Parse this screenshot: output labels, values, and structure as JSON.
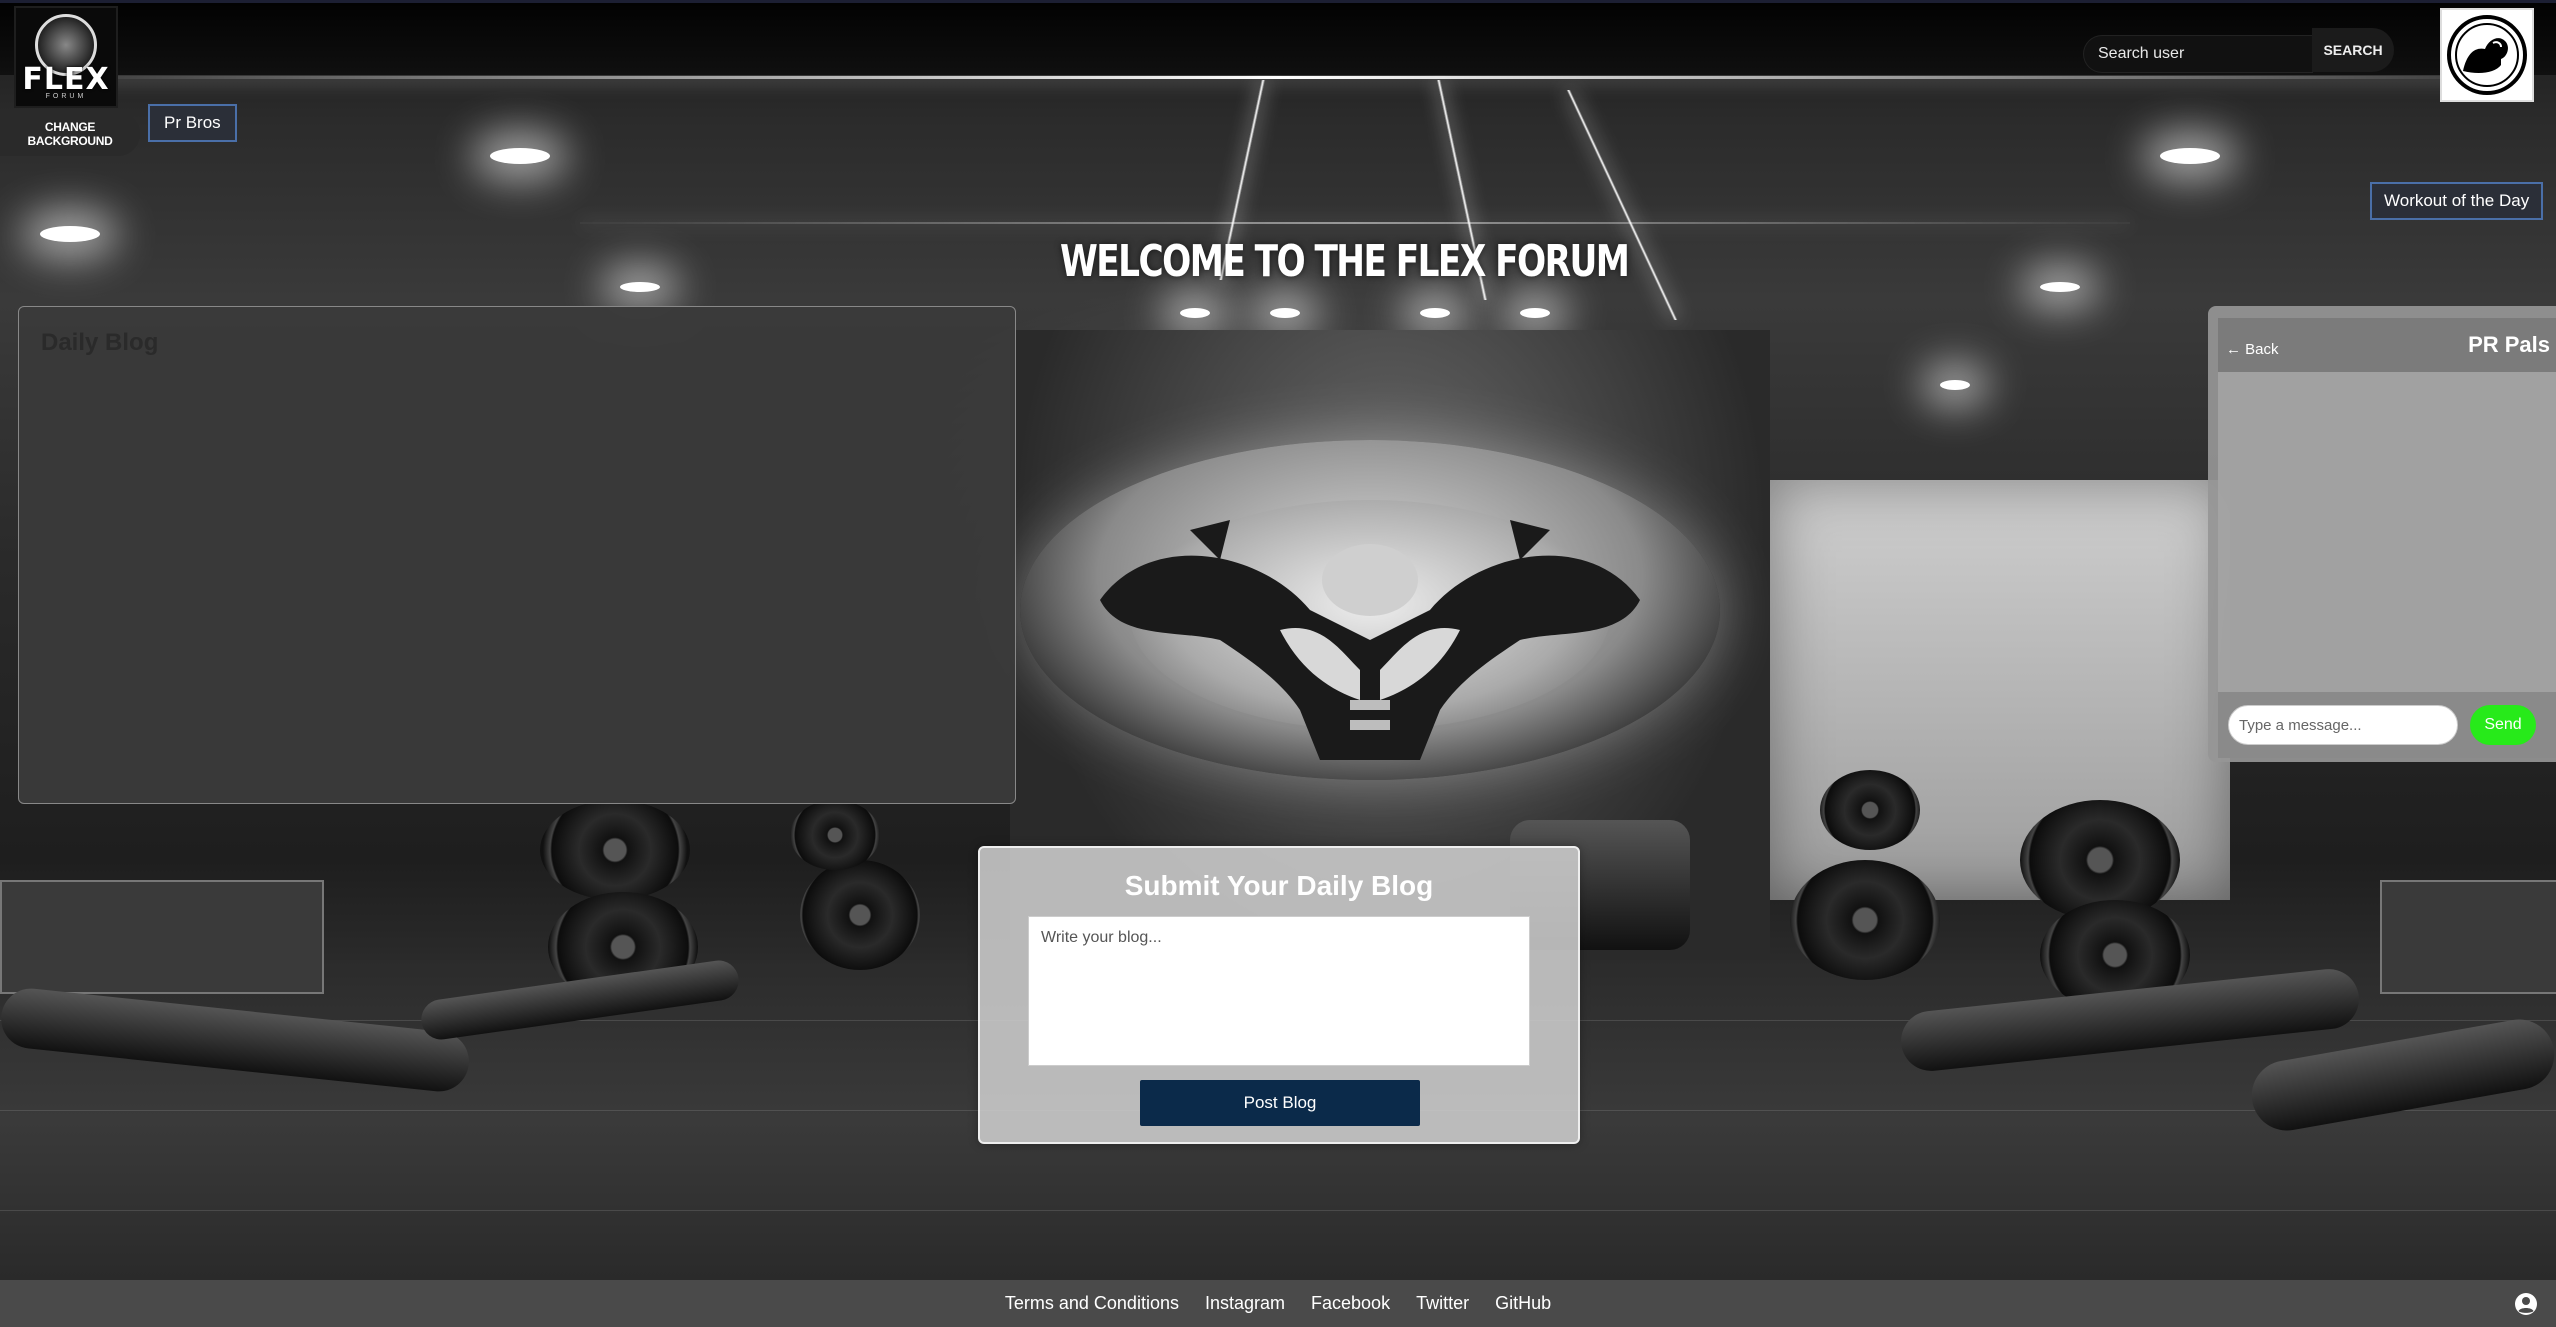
{
  "header": {
    "logo_text": "FLEX",
    "logo_sub": "FORUM",
    "search": {
      "placeholder": "Search user",
      "button_label": "SEARCH"
    },
    "change_background_label": "CHANGE BACKGROUND",
    "pr_bros_label": "Pr Bros",
    "workout_of_the_day_label": "Workout of the Day"
  },
  "main": {
    "welcome_title": "WELCOME TO THE FLEX FORUM",
    "daily_blog": {
      "title": "Daily Blog"
    },
    "submit": {
      "title": "Submit Your Daily Blog",
      "textarea_placeholder": "Write your blog...",
      "post_label": "Post Blog"
    }
  },
  "chat": {
    "back_label": "← Back",
    "title": "PR Pals",
    "input_placeholder": "Type a message...",
    "send_label": "Send"
  },
  "footer": {
    "links": [
      "Terms and Conditions",
      "Instagram",
      "Facebook",
      "Twitter",
      "GitHub"
    ]
  },
  "colors": {
    "send_green": "#27ea1a",
    "post_button_navy": "#0b2a4a",
    "pill_button_border": "#4a6fa8",
    "footer_bg": "#4a4a4a"
  },
  "icons": {
    "logo": "flex-forum-logo",
    "avatar": "flexing-arm-avatar-icon",
    "footer_user": "user-circle-icon"
  }
}
